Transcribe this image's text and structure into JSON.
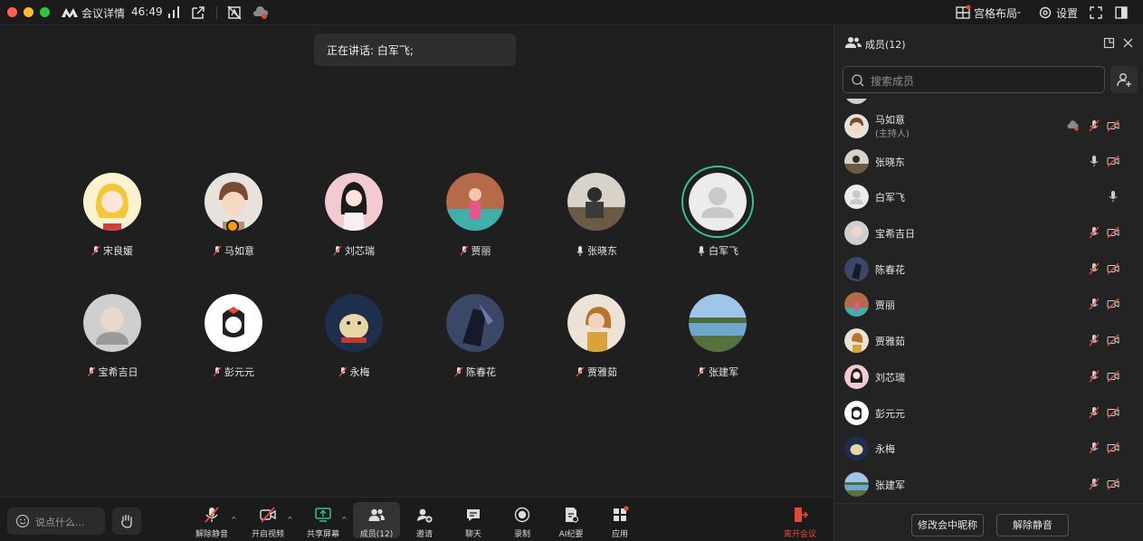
{
  "titlebar": {
    "meeting_details": "会议详情",
    "timer": "46:49",
    "layout_label": "宫格布局",
    "settings_label": "设置"
  },
  "stage": {
    "speaking_label": "正在讲话: 白军飞;"
  },
  "participants": [
    {
      "name": "宋良媛",
      "mic": "muted"
    },
    {
      "name": "马如意",
      "mic": "muted",
      "host": true
    },
    {
      "name": "刘芯瑞",
      "mic": "muted"
    },
    {
      "name": "贾丽",
      "mic": "muted"
    },
    {
      "name": "张晓东",
      "mic": "on"
    },
    {
      "name": "白军飞",
      "mic": "on",
      "speaking": true
    },
    {
      "name": "宝希吉日",
      "mic": "muted"
    },
    {
      "name": "彭元元",
      "mic": "muted"
    },
    {
      "name": "永梅",
      "mic": "muted"
    },
    {
      "name": "陈春花",
      "mic": "muted"
    },
    {
      "name": "贾雅茹",
      "mic": "muted"
    },
    {
      "name": "张建军",
      "mic": "muted"
    }
  ],
  "toolbar": {
    "chat_placeholder": "说点什么...",
    "unmute": "解除静音",
    "start_video": "开启视频",
    "share_screen": "共享屏幕",
    "members": "成员(12)",
    "invite": "邀请",
    "chat": "聊天",
    "record": "录制",
    "ai_minutes": "AI纪要",
    "apps": "应用",
    "leave": "离开会议"
  },
  "panel": {
    "title": "成员(12)",
    "search_placeholder": "搜索成员",
    "members": [
      {
        "name": "马如意",
        "sub": "(主持人)",
        "cloud": true,
        "mic": "muted",
        "video": "off"
      },
      {
        "name": "张晓东",
        "mic": "on",
        "video": "off"
      },
      {
        "name": "白军飞",
        "mic": "on",
        "video": "none"
      },
      {
        "name": "宝希吉日",
        "mic": "muted",
        "video": "off"
      },
      {
        "name": "陈春花",
        "mic": "muted",
        "video": "off"
      },
      {
        "name": "贾丽",
        "mic": "muted",
        "video": "off"
      },
      {
        "name": "贾雅茹",
        "mic": "muted",
        "video": "off"
      },
      {
        "name": "刘芯瑞",
        "mic": "muted",
        "video": "off"
      },
      {
        "name": "彭元元",
        "mic": "muted",
        "video": "off"
      },
      {
        "name": "永梅",
        "mic": "muted",
        "video": "off"
      },
      {
        "name": "张建军",
        "mic": "muted",
        "video": "off"
      }
    ],
    "rename_button": "修改会中昵称",
    "unmute_button": "解除静音"
  },
  "colors": {
    "accent_green": "#35c48f",
    "leave_red": "#e5483a",
    "host_orange": "#f39b1b"
  }
}
